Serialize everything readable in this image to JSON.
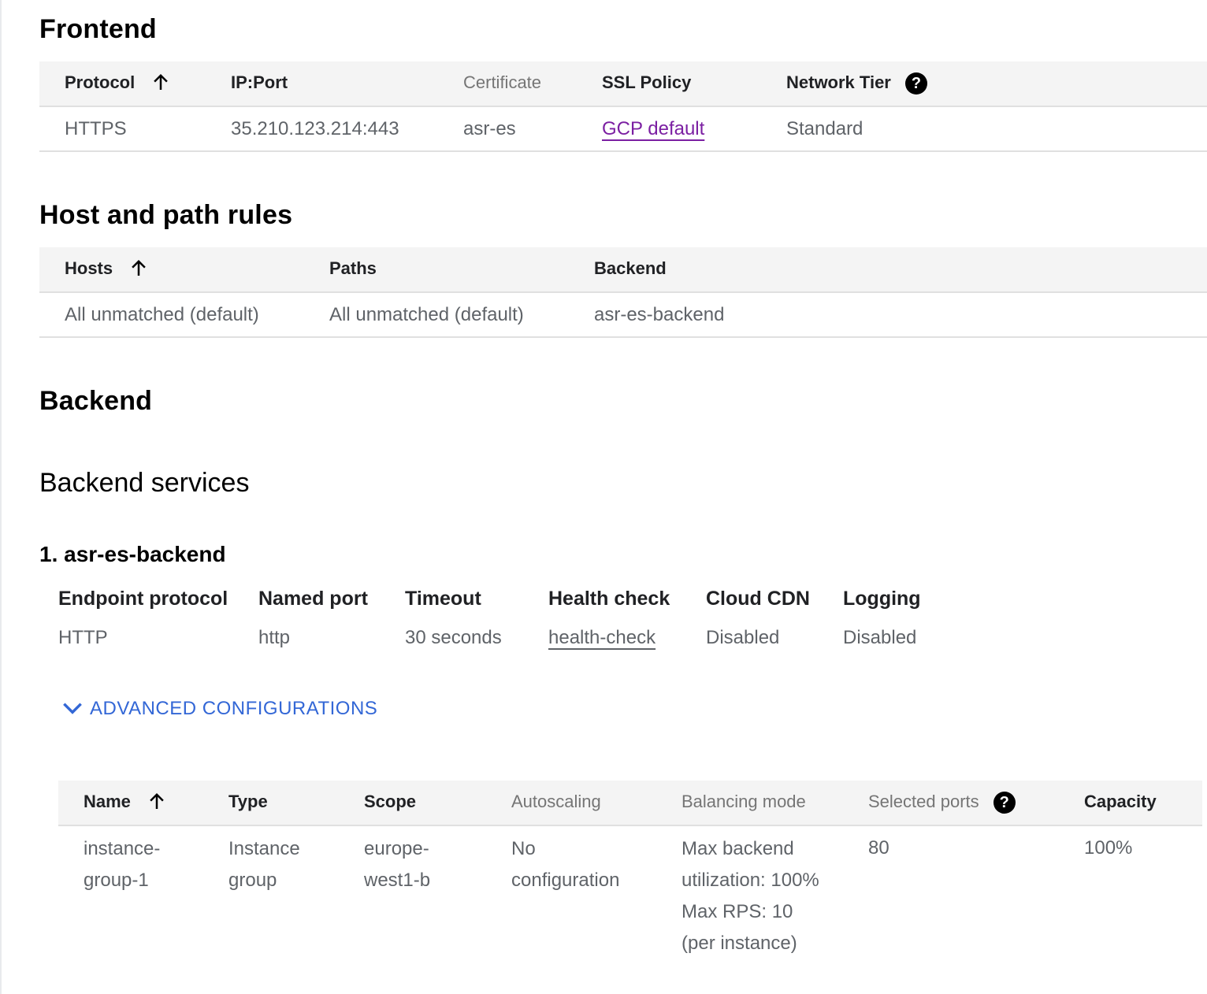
{
  "frontend": {
    "title": "Frontend",
    "columns": [
      "Protocol",
      "IP:Port",
      "Certificate",
      "SSL Policy",
      "Network Tier"
    ],
    "row": [
      "HTTPS",
      "35.210.123.214:443",
      "asr-es",
      "GCP default",
      "Standard"
    ]
  },
  "host_rules": {
    "title": "Host and path rules",
    "columns": [
      "Hosts",
      "Paths",
      "Backend"
    ],
    "row": [
      "All unmatched (default)",
      "All unmatched (default)",
      "asr-es-backend"
    ]
  },
  "backend": {
    "title": "Backend",
    "services_title": "Backend services",
    "service_name": "1. asr-es-backend",
    "props": {
      "labels": [
        "Endpoint protocol",
        "Named port",
        "Timeout",
        "Health check",
        "Cloud CDN",
        "Logging"
      ],
      "values": [
        "HTTP",
        "http",
        "30 seconds",
        "health-check",
        "Disabled",
        "Disabled"
      ]
    },
    "advanced_label": "ADVANCED CONFIGURATIONS",
    "instance_table": {
      "columns": [
        "Name",
        "Type",
        "Scope",
        "Autoscaling",
        "Balancing mode",
        "Selected ports",
        "Capacity"
      ],
      "row": [
        "instance-group-1",
        "Instance group",
        "europe-west1-b",
        "No configuration",
        "Max backend utilization: 100% Max RPS: 10 (per instance)",
        "80",
        "100%"
      ]
    }
  },
  "icons": [
    "arrow-up-icon",
    "help-icon",
    "chevron-down-icon"
  ],
  "colors": {
    "link": "#7b1fa2",
    "accent": "#3367d6",
    "header_bg": "#f4f4f4"
  }
}
